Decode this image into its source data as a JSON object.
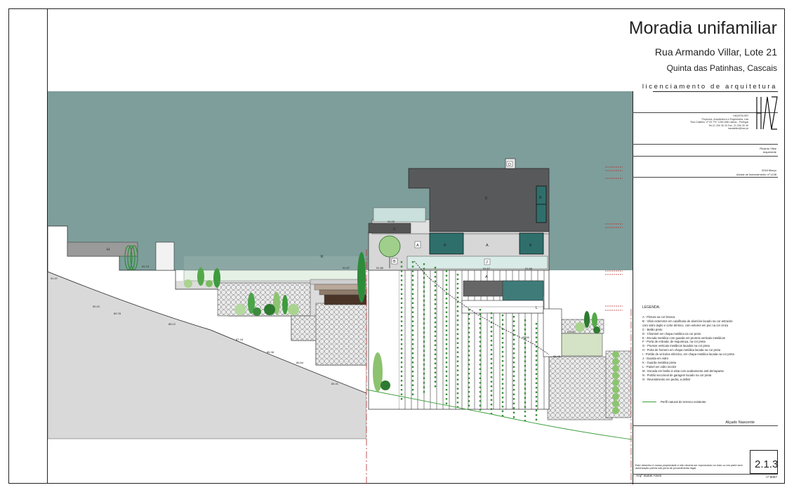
{
  "title": {
    "project": "Moradia unifamiliar",
    "address": "Rua Armando Villar, Lote 21",
    "locality": "Quinta das Patinhas, Cascais",
    "phase": "licenciamento de arquitetura"
  },
  "firm": {
    "lines": [
      "HAZATELIER",
      "Projectos, Arquitectura e Engenharia, Lda",
      "Rua Castilho, nº 53 7ºe. 1250-068 Lisboa - Portugal",
      "Tel.21 330 30 20  Fax. 21 330 30 39",
      "hazatelier@haz.pt"
    ],
    "logo": "HAZ"
  },
  "client": {
    "name": "Ricardo Villar",
    "role": "requerente"
  },
  "date": "2018 Março",
  "licence": "Alvará de licenciamento nº 1138",
  "legend": {
    "title": "LEGENDA:",
    "items": [
      "A - Pintura na cor branca",
      "B - Vãos exteriores em caixilharia de alumínio lacado na cor antracite",
      "      com vidro duplo e corte térmico, com estores em pvc na cor cinza",
      "C - Betão preto",
      "D - Chaminé em chapa metálica na cor preto",
      "E - Escada metálica com guarda em prumos verticais metálicos",
      "F - Porta de entrada, de segurança, na cor preta",
      "G - Prumos verticais metálicos lacados na cor preta",
      "H - Porta de homem em chapa metálica lacada na cor preta",
      "I - Portão de veículos eléctrico, em chapa metálica lacada na cor preta",
      "J - Guarda em vidro",
      "K - Guarda metálica preta",
      "L - Painel em vidro incolor",
      "M - Escada em betão à vista com acabamento anti-derrapante",
      "N - Portão seccional de garagem lacado na cor preta",
      "O - Revestimento em pedra, a definir"
    ],
    "terrain": "Perfil natural do terreno existente"
  },
  "view_name": "Alçado Nascente",
  "note": "Este desenho é nossa propriedade e não deverá ser reproduzido no todo ou em parte sem autorização prévia sob pena de procedimento legal.",
  "architect": "Arqª Isabel Alves",
  "sheet": {
    "number": "2.1.3",
    "ref": "nº 8067"
  },
  "levels": [
    "91.97",
    "90.22",
    "89.78",
    "88.12",
    "87.18",
    "86.38",
    "85.84",
    "84.41",
    "91.73",
    "91.57",
    "91.86",
    "94.02",
    "91.57",
    "91.68",
    "87.85",
    "86.45",
    "87.50"
  ],
  "material_labels": {
    "a": "A",
    "b": "B",
    "c": "C",
    "d": "D",
    "e": "E",
    "h": "H",
    "j": "J",
    "k": "K",
    "l": "L"
  },
  "colors": {
    "sky": "#7e9e9b",
    "roof": "#58595b",
    "window": "#2f6f6b",
    "wall": "#d7d7d7",
    "glass": "#c9e0dc",
    "ground": "#d9d9d9",
    "stone": "#e4e4e4",
    "terrain_line": "#3a9e3a",
    "cut_line": "#b03030"
  }
}
